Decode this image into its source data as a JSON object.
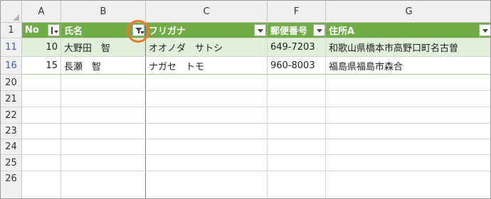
{
  "columns": [
    "A",
    "B",
    "C",
    "F",
    "G"
  ],
  "row_numbers": [
    "1",
    "11",
    "16",
    "20",
    "21",
    "22",
    "23",
    "24",
    "25",
    "26"
  ],
  "table_header": {
    "no": "No",
    "name": "氏名",
    "furigana": "フリガナ",
    "postal": "郵便番号",
    "address": "住所A"
  },
  "rows": [
    {
      "no": "10",
      "name": "大野田　智",
      "furigana": "オオノダ　サトシ",
      "postal": "649-7203",
      "address": "和歌山県橋本市高野口町名古曽"
    },
    {
      "no": "15",
      "name": "長瀬　智",
      "furigana": "ナガセ　トモ",
      "postal": "960-8003",
      "address": "福島県福島市森合"
    }
  ],
  "colors": {
    "header_green": "#70ad47",
    "band_green": "#e2efda",
    "filtered_row_number": "#2e5bd6",
    "highlight_ring": "#f07a2a"
  },
  "icons": {
    "no_filter": "sort-dropdown-icon",
    "name_filter": "filter-applied-icon",
    "other_filters": "dropdown-arrow-icon"
  }
}
